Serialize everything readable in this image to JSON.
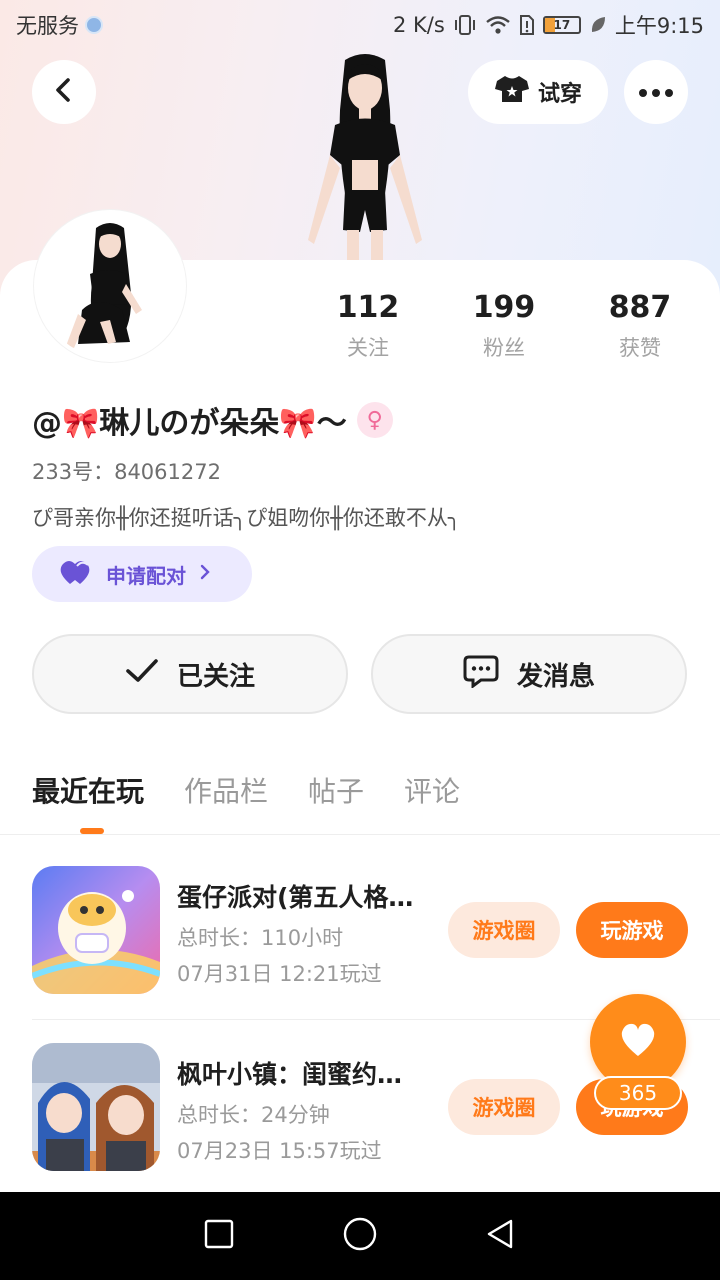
{
  "status_bar": {
    "carrier": "无服务",
    "speed": "2 K/s",
    "battery": "17",
    "time": "上午9:15"
  },
  "header": {
    "back_icon": "chevron-left-icon",
    "tryon_label": "试穿",
    "tryon_icon": "shirt-icon",
    "more_icon": "more-dots-icon"
  },
  "profile": {
    "nickname": "@🎀琳儿のが朵朵🎀～",
    "gender_symbol": "♀",
    "uid": "233号：84061272",
    "bio": "ぴ哥亲你╫你还挺听话╮ぴ姐吻你╫你还敢不从╮",
    "pair_label": "申请配对",
    "stats": [
      {
        "num": "112",
        "label": "关注"
      },
      {
        "num": "199",
        "label": "粉丝"
      },
      {
        "num": "887",
        "label": "获赞"
      }
    ]
  },
  "actions": {
    "follow_label": "已关注",
    "message_label": "发消息"
  },
  "tabs": [
    "最近在玩",
    "作品栏",
    "帖子",
    "评论"
  ],
  "games": [
    {
      "title": "蛋仔派对(第五人格…",
      "duration": "总时长：110小时",
      "last_played": "07月31日 12:21玩过",
      "circle_label": "游戏圈",
      "play_label": "玩游戏"
    },
    {
      "title": "枫叶小镇：闺蜜约…",
      "duration": "总时长：24分钟",
      "last_played": "07月23日 15:57玩过",
      "circle_label": "游戏圈",
      "play_label": "玩游戏"
    }
  ],
  "like_fab": {
    "count": "365"
  },
  "colors": {
    "accent": "#ff7a1a",
    "pair": "#6a53d6"
  }
}
